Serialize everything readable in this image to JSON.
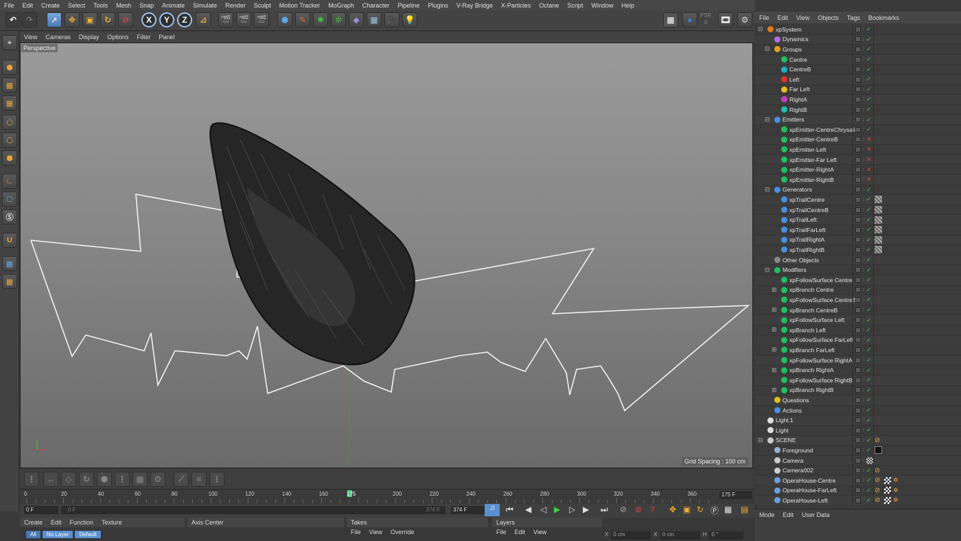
{
  "menubar": [
    "File",
    "Edit",
    "Create",
    "Select",
    "Tools",
    "Mesh",
    "Snap",
    "Animate",
    "Simulate",
    "Render",
    "Sculpt",
    "Motion Tracker",
    "MoGraph",
    "Character",
    "Pipeline",
    "Plugins",
    "V-Ray Bridge",
    "X-Particles",
    "Octane",
    "Script",
    "Window",
    "Help"
  ],
  "toolbar": {
    "axis_x": "X",
    "axis_y": "Y",
    "axis_z": "Z",
    "psr_label": "PSR",
    "psr_value": "0"
  },
  "viewport": {
    "menu": [
      "View",
      "Cameras",
      "Display",
      "Options",
      "Filter",
      "Panel"
    ],
    "label": "Perspective",
    "grid_spacing": "Grid Spacing : 100 cm"
  },
  "timeline": {
    "ticks": [
      "0",
      "20",
      "40",
      "60",
      "80",
      "100",
      "120",
      "140",
      "160",
      "175",
      "200",
      "220",
      "240",
      "260",
      "280",
      "300",
      "320",
      "340",
      "360"
    ],
    "current_frame": "175",
    "end_field": "175 F",
    "start_field": "0 F",
    "range_start": "0 F",
    "range_end": "374 F",
    "max_field": "374 F"
  },
  "bottom": {
    "materials_menu": [
      "Create",
      "Edit",
      "Function",
      "Texture"
    ],
    "layer_tabs": [
      "All",
      "No Layer",
      "Default"
    ],
    "axis_center": "Axis Center",
    "takes": "Takes",
    "takes_menu": [
      "File",
      "View",
      "Override"
    ],
    "layers": "Layers",
    "layers_menu": [
      "File",
      "Edit",
      "View"
    ],
    "coords": {
      "x_label": "X",
      "x_val": "0 cm",
      "x2_label": "X",
      "x2_val": "0 cm",
      "h_label": "H",
      "h_val": "0 °"
    }
  },
  "objects_menu": [
    "File",
    "Edit",
    "View",
    "Objects",
    "Tags",
    "Bookmarks"
  ],
  "objects": [
    {
      "label": "xpSystem",
      "indent": 0,
      "color": "#e07a1f",
      "exp": "-"
    },
    {
      "label": "Dynamics",
      "indent": 1,
      "color": "#b070e0",
      "exp": ""
    },
    {
      "label": "Groups",
      "indent": 1,
      "color": "#e0a020",
      "exp": "-"
    },
    {
      "label": "Centre",
      "indent": 2,
      "color": "#20c060",
      "exp": ""
    },
    {
      "label": "CentreB",
      "indent": 2,
      "color": "#20b0c0",
      "exp": ""
    },
    {
      "label": "Left",
      "indent": 2,
      "color": "#e03030",
      "exp": ""
    },
    {
      "label": "Far Left",
      "indent": 2,
      "color": "#e0c020",
      "exp": ""
    },
    {
      "label": "RightA",
      "indent": 2,
      "color": "#c040c0",
      "exp": ""
    },
    {
      "label": "RightB",
      "indent": 2,
      "color": "#20c0b0",
      "exp": ""
    },
    {
      "label": "Emitters",
      "indent": 1,
      "color": "#4a90e0",
      "exp": "-"
    },
    {
      "label": "xpEmitter-CentreChrysalis",
      "indent": 2,
      "color": "#20c060",
      "exp": ""
    },
    {
      "label": "xpEmitter-CentreB",
      "indent": 2,
      "color": "#20c060",
      "exp": "",
      "x": true
    },
    {
      "label": "xpEmitter-Left",
      "indent": 2,
      "color": "#20c060",
      "exp": "",
      "x": true
    },
    {
      "label": "xpEmitter-Far Left",
      "indent": 2,
      "color": "#20c060",
      "exp": "",
      "x": true
    },
    {
      "label": "xpEmitter-RightA",
      "indent": 2,
      "color": "#20c060",
      "exp": "",
      "x": true
    },
    {
      "label": "xpEmitter-RightB",
      "indent": 2,
      "color": "#20c060",
      "exp": "",
      "x": true
    },
    {
      "label": "Generators",
      "indent": 1,
      "color": "#4a90e0",
      "exp": "-"
    },
    {
      "label": "xpTrailCentre",
      "indent": 2,
      "color": "#4a90e0",
      "exp": "",
      "tag": true
    },
    {
      "label": "xpTrailCentreB",
      "indent": 2,
      "color": "#4a90e0",
      "exp": "",
      "tag": true
    },
    {
      "label": "xpTrailLeft",
      "indent": 2,
      "color": "#4a90e0",
      "exp": "",
      "tag": true
    },
    {
      "label": "xpTrailFarLeft",
      "indent": 2,
      "color": "#4a90e0",
      "exp": "",
      "tag": true
    },
    {
      "label": "xpTrailRightA",
      "indent": 2,
      "color": "#4a90e0",
      "exp": "",
      "tag": true
    },
    {
      "label": "xpTrailRightB",
      "indent": 2,
      "color": "#4a90e0",
      "exp": "",
      "tag": true
    },
    {
      "label": "Other Objects",
      "indent": 1,
      "color": "#888888",
      "exp": ""
    },
    {
      "label": "Modifiers",
      "indent": 1,
      "color": "#20c060",
      "exp": "-"
    },
    {
      "label": "xpFollowSurface Centre",
      "indent": 2,
      "color": "#20c060",
      "exp": ""
    },
    {
      "label": "xpBranch Centre",
      "indent": 2,
      "color": "#20c060",
      "exp": "+"
    },
    {
      "label": "xpFollowSurface CentreB",
      "indent": 2,
      "color": "#20c060",
      "exp": ""
    },
    {
      "label": "xpBranch CentreB",
      "indent": 2,
      "color": "#20c060",
      "exp": "+"
    },
    {
      "label": "xpFollowSurface Left",
      "indent": 2,
      "color": "#20c060",
      "exp": ""
    },
    {
      "label": "xpBranch Left",
      "indent": 2,
      "color": "#20c060",
      "exp": "+"
    },
    {
      "label": "xpFollowSurface FarLeft",
      "indent": 2,
      "color": "#20c060",
      "exp": ""
    },
    {
      "label": "xpBranch FarLeft",
      "indent": 2,
      "color": "#20c060",
      "exp": "+"
    },
    {
      "label": "xpFollowSurface RightA",
      "indent": 2,
      "color": "#20c060",
      "exp": ""
    },
    {
      "label": "xpBranch RightA",
      "indent": 2,
      "color": "#20c060",
      "exp": "+"
    },
    {
      "label": "xpFollowSurface RightB",
      "indent": 2,
      "color": "#20c060",
      "exp": ""
    },
    {
      "label": "xpBranch RightB",
      "indent": 2,
      "color": "#20c060",
      "exp": "+"
    },
    {
      "label": "Questions",
      "indent": 1,
      "color": "#e0c020",
      "exp": ""
    },
    {
      "label": "Actions",
      "indent": 1,
      "color": "#4a90e0",
      "exp": ""
    },
    {
      "label": "Light.1",
      "indent": 0,
      "color": "#dddddd",
      "exp": ""
    },
    {
      "label": "Light",
      "indent": 0,
      "color": "#dddddd",
      "exp": ""
    },
    {
      "label": "SCENE",
      "indent": 0,
      "color": "#cccccc",
      "exp": "-",
      "cx": true
    },
    {
      "label": "Foreground",
      "indent": 1,
      "color": "#9ab0d0",
      "exp": "",
      "fg": true
    },
    {
      "label": "Camera",
      "indent": 1,
      "color": "#cccccc",
      "exp": "",
      "cam": true
    },
    {
      "label": "Camera002",
      "indent": 1,
      "color": "#cccccc",
      "exp": "",
      "cx": true
    },
    {
      "label": "OperaHouse-Centre",
      "indent": 1,
      "color": "#6aa0e0",
      "exp": "",
      "mat": true
    },
    {
      "label": "OperaHouse-FarLeft",
      "indent": 1,
      "color": "#6aa0e0",
      "exp": "",
      "mat": true
    },
    {
      "label": "OperaHouse-Left",
      "indent": 1,
      "color": "#6aa0e0",
      "exp": "",
      "mat": true
    }
  ],
  "attributes_menu": [
    "Mode",
    "Edit",
    "User Data"
  ],
  "colors": {
    "accent": "#4a90e0",
    "check": "#3fd03f",
    "xmark": "#e04040",
    "playhead": "#3fd080"
  }
}
